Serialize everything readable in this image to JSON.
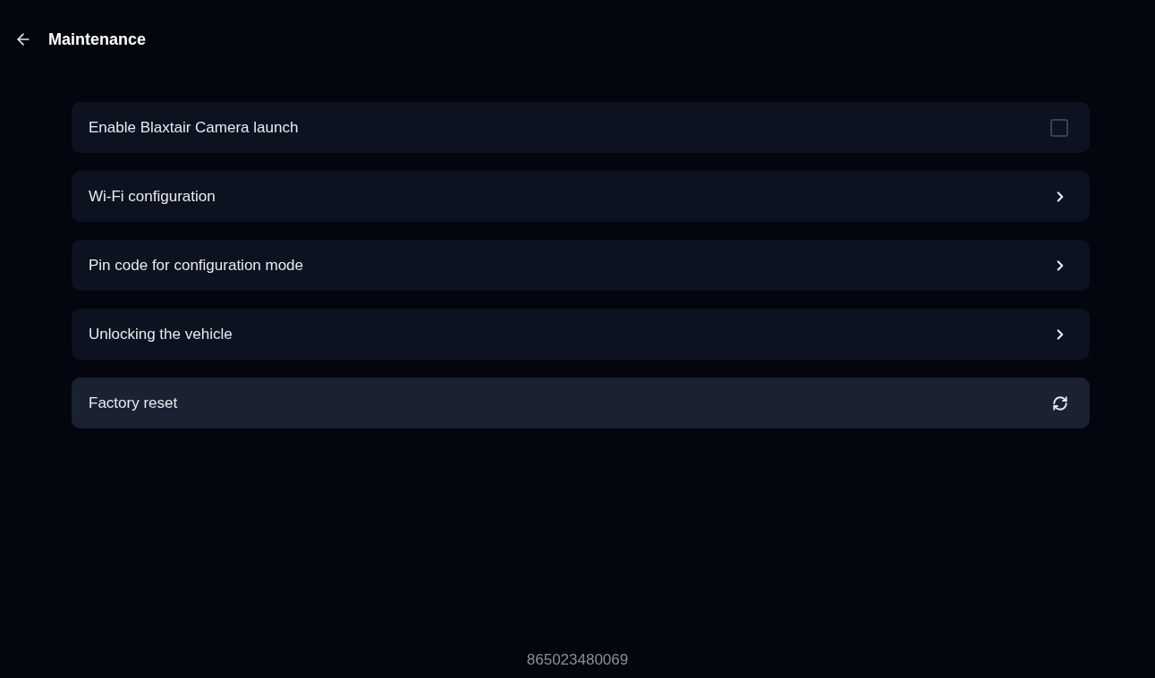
{
  "header": {
    "title": "Maintenance"
  },
  "items": [
    {
      "kind": "checkbox",
      "label": "Enable Blaxtair Camera launch",
      "checked": false,
      "selected": false
    },
    {
      "kind": "link",
      "label": "Wi-Fi configuration",
      "selected": false
    },
    {
      "kind": "link",
      "label": "Pin code for configuration mode",
      "selected": false
    },
    {
      "kind": "link",
      "label": "Unlocking the vehicle",
      "selected": false
    },
    {
      "kind": "action",
      "label": "Factory reset",
      "selected": true
    }
  ],
  "footer": {
    "serial": "865023480069"
  }
}
